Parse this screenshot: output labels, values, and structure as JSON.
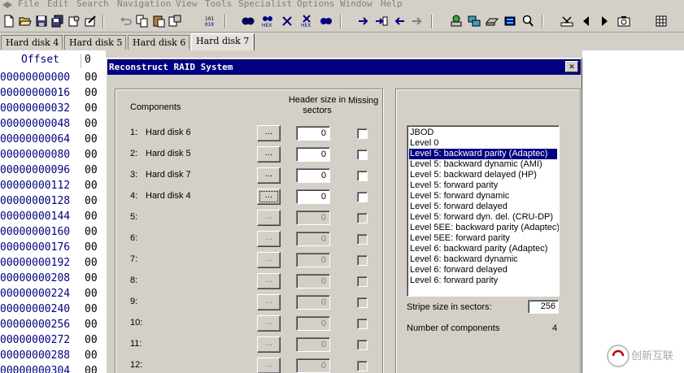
{
  "menu": {
    "items": [
      "File",
      "Edit",
      "Search",
      "Navigation",
      "View",
      "Tools",
      "Specialist",
      "Options",
      "Window",
      "Help"
    ]
  },
  "tabs": [
    "Hard disk 4",
    "Hard disk 5",
    "Hard disk 6",
    "Hard disk 7"
  ],
  "active_tab": "Hard disk 7",
  "hex": {
    "offset_header": "Offset",
    "col_header": "0",
    "rows": [
      {
        "offset": "00000000000",
        "byte": "00"
      },
      {
        "offset": "00000000016",
        "byte": "00"
      },
      {
        "offset": "00000000032",
        "byte": "00"
      },
      {
        "offset": "00000000048",
        "byte": "00"
      },
      {
        "offset": "00000000064",
        "byte": "00"
      },
      {
        "offset": "00000000080",
        "byte": "00"
      },
      {
        "offset": "00000000096",
        "byte": "00"
      },
      {
        "offset": "00000000112",
        "byte": "00"
      },
      {
        "offset": "00000000128",
        "byte": "00"
      },
      {
        "offset": "00000000144",
        "byte": "00"
      },
      {
        "offset": "00000000160",
        "byte": "00"
      },
      {
        "offset": "00000000176",
        "byte": "00"
      },
      {
        "offset": "00000000192",
        "byte": "00"
      },
      {
        "offset": "00000000208",
        "byte": "00"
      },
      {
        "offset": "00000000224",
        "byte": "00"
      },
      {
        "offset": "00000000240",
        "byte": "00"
      },
      {
        "offset": "00000000256",
        "byte": "00"
      },
      {
        "offset": "00000000272",
        "byte": "00"
      },
      {
        "offset": "00000000288",
        "byte": "00"
      },
      {
        "offset": "00000000304",
        "byte": "00"
      }
    ]
  },
  "dialog": {
    "title": "Reconstruct RAID System",
    "close_label": "✕",
    "components_label": "Components",
    "header_size_label": "Header size in sectors",
    "missing_label": "Missing",
    "browse_label": "...",
    "components": [
      {
        "num": "1:",
        "name": "Hard disk 6",
        "header": "0",
        "enabled": true
      },
      {
        "num": "2:",
        "name": "Hard disk 5",
        "header": "0",
        "enabled": true
      },
      {
        "num": "3:",
        "name": "Hard disk 7",
        "header": "0",
        "enabled": true
      },
      {
        "num": "4:",
        "name": "Hard disk 4",
        "header": "0",
        "enabled": true
      },
      {
        "num": "5:",
        "name": "",
        "header": "0",
        "enabled": false
      },
      {
        "num": "6:",
        "name": "",
        "header": "0",
        "enabled": false
      },
      {
        "num": "7:",
        "name": "",
        "header": "0",
        "enabled": false
      },
      {
        "num": "8:",
        "name": "",
        "header": "0",
        "enabled": false
      },
      {
        "num": "9:",
        "name": "",
        "header": "0",
        "enabled": false
      },
      {
        "num": "10:",
        "name": "",
        "header": "0",
        "enabled": false
      },
      {
        "num": "11:",
        "name": "",
        "header": "0",
        "enabled": false
      },
      {
        "num": "12:",
        "name": "",
        "header": "0",
        "enabled": false
      }
    ],
    "raid_types": [
      "JBOD",
      "Level 0",
      "Level 5: backward parity (Adaptec)",
      "Level 5: backward dynamic (AMI)",
      "Level 5: backward delayed (HP)",
      "Level 5: forward parity",
      "Level 5: forward dynamic",
      "Level 5: forward delayed",
      "Level 5: forward dyn. del. (CRU-DP)",
      "Level 5EE: backward parity (Adaptec)",
      "Level 5EE: forward parity",
      "Level 6: backward parity (Adaptec)",
      "Level 6: backward dynamic",
      "Level 6: forward delayed",
      "Level 6: forward parity"
    ],
    "selected_raid": "Level 5: backward parity (Adaptec)",
    "stripe_label": "Stripe size in sectors:",
    "stripe_value": "256",
    "num_components_label": "Number of components",
    "num_components_value": "4"
  },
  "watermark_text": "创新互联",
  "colors": {
    "window_bg": "#d4d0c8",
    "title_bar": "#000080",
    "selection": "#000080",
    "offset_text": "#000080"
  }
}
